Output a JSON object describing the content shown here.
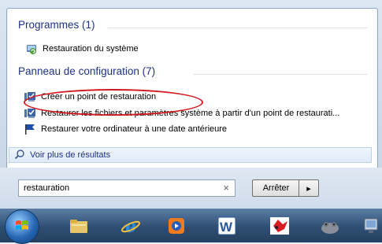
{
  "sections": {
    "programs": {
      "header": "Programmes (1)",
      "items": [
        {
          "label": "Restauration du système",
          "icon": "system-restore-icon"
        }
      ]
    },
    "control_panel": {
      "header": "Panneau de configuration (7)",
      "items": [
        {
          "label": "Créer un point de restauration",
          "icon": "shield-monitor-icon"
        },
        {
          "label": "Restaurer les fichiers et paramètres système à partir d'un point de restaurati...",
          "icon": "shield-monitor-icon"
        },
        {
          "label": "Restaurer votre ordinateur à une date antérieure",
          "icon": "flag-icon"
        }
      ]
    }
  },
  "more_results": {
    "label": "Voir plus de résultats",
    "icon": "search-icon"
  },
  "search": {
    "value": "restauration",
    "clear_glyph": "×"
  },
  "buttons": {
    "shutdown_label": "Arrêter",
    "arrow_glyph": "▸"
  },
  "taskbar": {
    "items": [
      {
        "name": "start-orb",
        "icon": "windows-logo-icon"
      },
      {
        "name": "explorer",
        "icon": "folder-icon"
      },
      {
        "name": "internet-explorer",
        "icon": "ie-icon"
      },
      {
        "name": "media-player",
        "icon": "media-player-icon"
      },
      {
        "name": "word",
        "icon": "word-icon"
      },
      {
        "name": "paint",
        "icon": "paint-icon"
      },
      {
        "name": "game",
        "icon": "hippo-icon"
      },
      {
        "name": "network",
        "icon": "network-icon"
      }
    ]
  },
  "colors": {
    "header_text": "#1e3287",
    "highlight": "#d0161b",
    "taskbar": "#2f4e73"
  }
}
